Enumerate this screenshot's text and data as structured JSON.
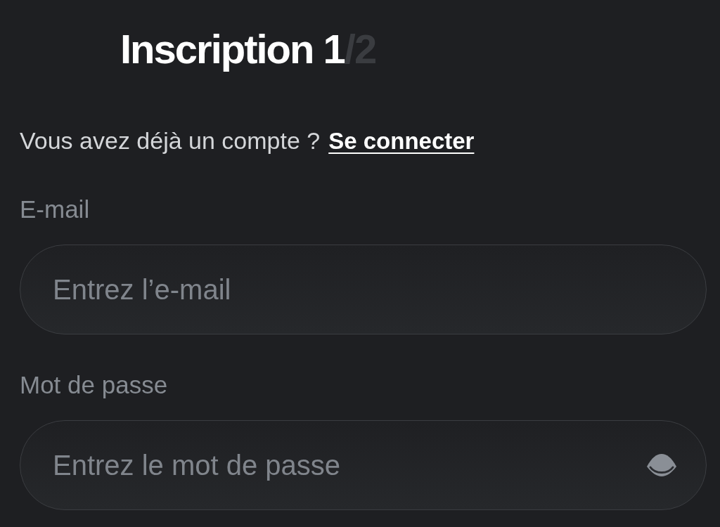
{
  "title": {
    "main": "Inscription 1",
    "suffix": "/2"
  },
  "login_prompt": {
    "text": "Vous avez déjà un compte ?",
    "link": "Se connecter"
  },
  "fields": [
    {
      "kind": "email",
      "label": "E-mail",
      "placeholder": "Entrez l’e-mail"
    },
    {
      "kind": "password",
      "label": "Mot de passe",
      "placeholder": "Entrez le mot de passe"
    }
  ]
}
